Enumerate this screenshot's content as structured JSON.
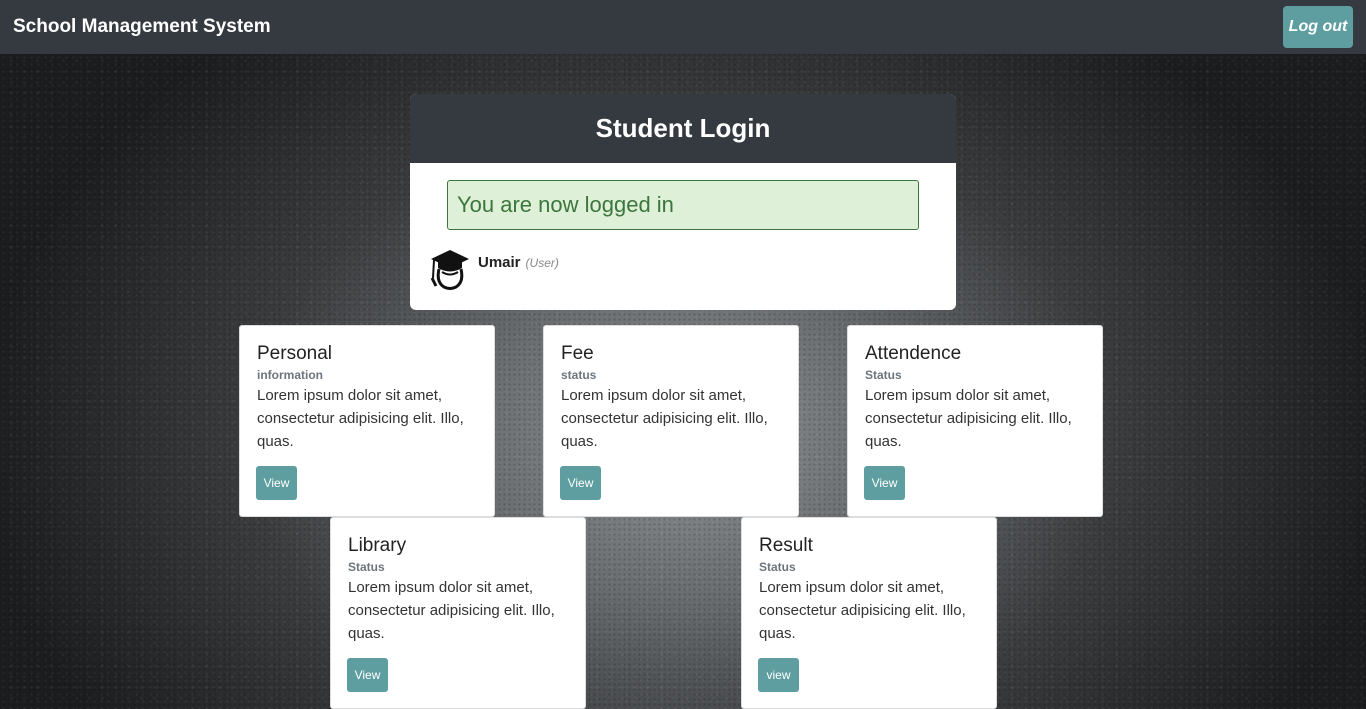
{
  "navbar": {
    "brand": "School Management System",
    "logout_label": "Log out"
  },
  "login": {
    "title": "Student Login",
    "alert": "You are now logged in",
    "user_name": "Umair",
    "user_role": "(User)",
    "avatar_icon": "graduate-cap-icon"
  },
  "cards": [
    {
      "title": "Personal",
      "subtitle": "information",
      "text": "Lorem ipsum dolor sit amet, consectetur adipisicing elit. Illo, quas.",
      "button": "View"
    },
    {
      "title": "Fee",
      "subtitle": "status",
      "text": "Lorem ipsum dolor sit amet, consectetur adipisicing elit. Illo, quas.",
      "button": "View"
    },
    {
      "title": "Attendence",
      "subtitle": "Status",
      "text": "Lorem ipsum dolor sit amet, consectetur adipisicing elit. Illo, quas.",
      "button": "View"
    },
    {
      "title": "Library",
      "subtitle": "Status",
      "text": "Lorem ipsum dolor sit amet, consectetur adipisicing elit. Illo, quas.",
      "button": "View"
    },
    {
      "title": "Result",
      "subtitle": "Status",
      "text": "Lorem ipsum dolor sit amet, consectetur adipisicing elit. Illo, quas.",
      "button": "view"
    }
  ],
  "colors": {
    "navbar": "#343a40",
    "accent": "#5f9ea0",
    "alert_bg": "#dff0d8",
    "alert_text": "#3c763d"
  }
}
